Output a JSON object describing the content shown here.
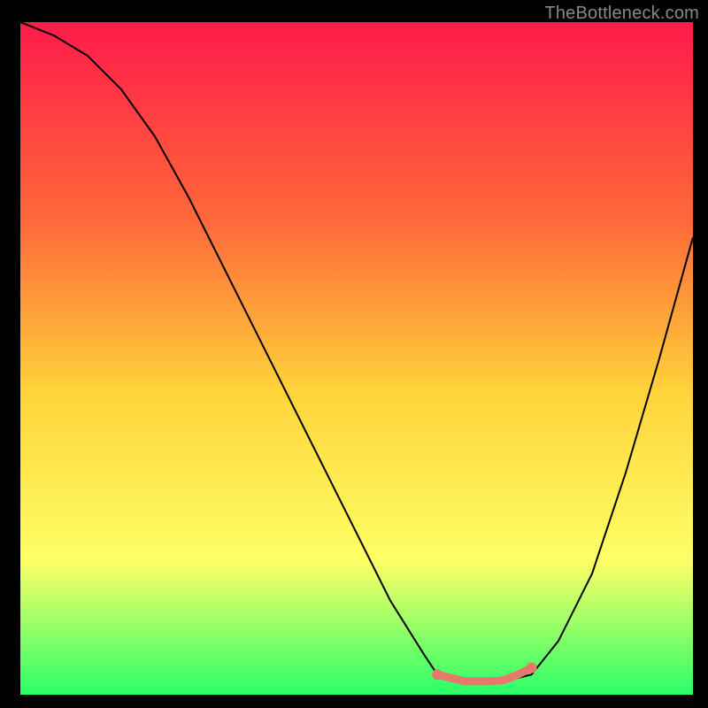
{
  "watermark": "TheBottleneck.com",
  "colors": {
    "background": "#000000",
    "grad_top": "#ff1b4a",
    "grad_mid1": "#ff6a3a",
    "grad_mid2": "#ffd33a",
    "grad_mid3": "#ffff66",
    "grad_bottom": "#2aff6a",
    "curve": "#000000",
    "marker_fill": "#e8786b",
    "marker_stroke": "#e8786b"
  },
  "chart_data": {
    "type": "line",
    "title": "",
    "xlabel": "",
    "ylabel": "",
    "xlim": [
      0,
      100
    ],
    "ylim": [
      0,
      100
    ],
    "series": [
      {
        "name": "bottleneck-curve",
        "x": [
          0,
          5,
          10,
          15,
          20,
          25,
          30,
          35,
          40,
          45,
          50,
          55,
          60,
          62,
          66,
          72,
          76,
          80,
          85,
          90,
          95,
          100
        ],
        "y": [
          100,
          98,
          95,
          90,
          83,
          74,
          64,
          54,
          44,
          34,
          24,
          14,
          6,
          3,
          2,
          2,
          3,
          8,
          18,
          33,
          50,
          68
        ]
      }
    ],
    "markers": {
      "name": "highlight-range",
      "x": [
        62,
        64,
        66,
        68,
        70,
        72,
        74,
        76
      ],
      "y": [
        3,
        2.5,
        2,
        2,
        2,
        2.2,
        3,
        4
      ]
    }
  }
}
